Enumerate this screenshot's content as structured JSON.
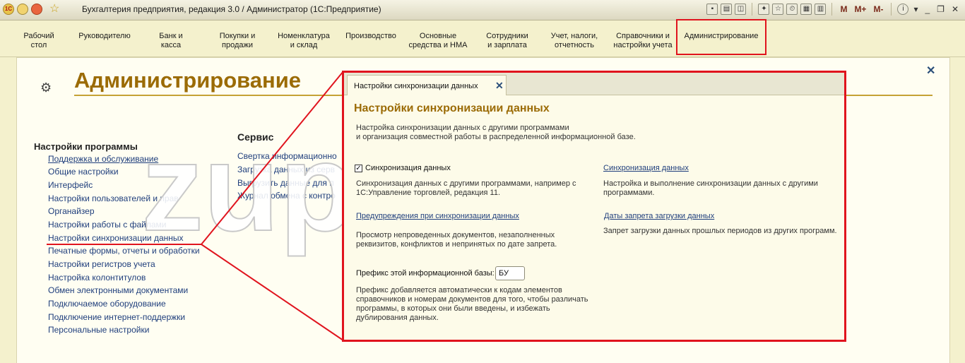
{
  "app": {
    "title": "Бухгалтерия предприятия, редакция 3.0 / Администратор  (1С:Предприятие)",
    "logo_text": "1С",
    "toolbar_buttons": [
      "M",
      "M+",
      "M-"
    ],
    "window_buttons": [
      "_",
      "❐",
      "✕"
    ]
  },
  "sections": [
    {
      "label": "Рабочий\nстол"
    },
    {
      "label": "Руководителю"
    },
    {
      "label": "Банк и\nкасса"
    },
    {
      "label": "Покупки и\nпродажи"
    },
    {
      "label": "Номенклатура\nи склад"
    },
    {
      "label": "Производство"
    },
    {
      "label": "Основные\nсредства и НМА"
    },
    {
      "label": "Сотрудники\nи зарплата"
    },
    {
      "label": "Учет, налоги,\nотчетность"
    },
    {
      "label": "Справочники и\nнастройки учета"
    },
    {
      "label": "Администрирование",
      "active": true
    }
  ],
  "page": {
    "title": "Администрирование",
    "program_settings": {
      "heading": "Настройки программы",
      "items": [
        "Поддержка и обслуживание",
        "Общие настройки",
        "Интерфейс",
        "Настройки пользователей и прав",
        "Органайзер",
        "Настройки работы с файлами",
        "Настройки синхронизации данных",
        "Печатные формы, отчеты и обработки",
        "Настройки регистров учета",
        "Настройка колонтитулов",
        "Обмен электронными документами",
        "Подключаемое оборудование",
        "Подключение интернет-поддержки",
        "Персональные настройки"
      ]
    },
    "service": {
      "heading": "Сервис",
      "items": [
        "Свертка информационно",
        "Загрузка данных из серв",
        "Выгрузить данные для п",
        "Журнал обмена с контро"
      ]
    }
  },
  "watermark": "zup1c.ru",
  "sync_form": {
    "tab_label": "Настройки синхронизации данных",
    "title": "Настройки синхронизации данных",
    "intro_line1": "Настройка синхронизации данных с другими программами",
    "intro_line2": "и организация совместной работы в распределенной информационной базе.",
    "sync_checkbox_label": "Синхронизация данных",
    "sync_checkbox_checked": true,
    "sync_checkbox_desc1": "Синхронизация данных с другими программами, например с",
    "sync_checkbox_desc2": "1С:Управление торговлей, редакция 11.",
    "sync_link": "Синхронизация данных",
    "sync_link_desc1": "Настройка и выполнение синхронизации данных с другими",
    "sync_link_desc2": "программами.",
    "warnings_link": "Предупреждения при синхронизации данных",
    "warnings_desc1": "Просмотр непроведенных документов, незаполненных",
    "warnings_desc2": "реквизитов, конфликтов и непринятых по дате запрета.",
    "dates_link": "Даты запрета загрузки данных",
    "dates_desc": "Запрет загрузки данных прошлых периодов из других программ.",
    "prefix_label": "Префикс этой информационной базы:",
    "prefix_value": "БУ",
    "prefix_desc1": "Префикс добавляется автоматически к кодам элементов",
    "prefix_desc2": "справочников и номерам документов для того, чтобы различать",
    "prefix_desc3": "программы, в которых они были введены, и избежать",
    "prefix_desc4": "дублирования данных."
  },
  "colors": {
    "highlight": "#e0141e",
    "title": "#9b6b05",
    "link": "#1f3e7c"
  }
}
